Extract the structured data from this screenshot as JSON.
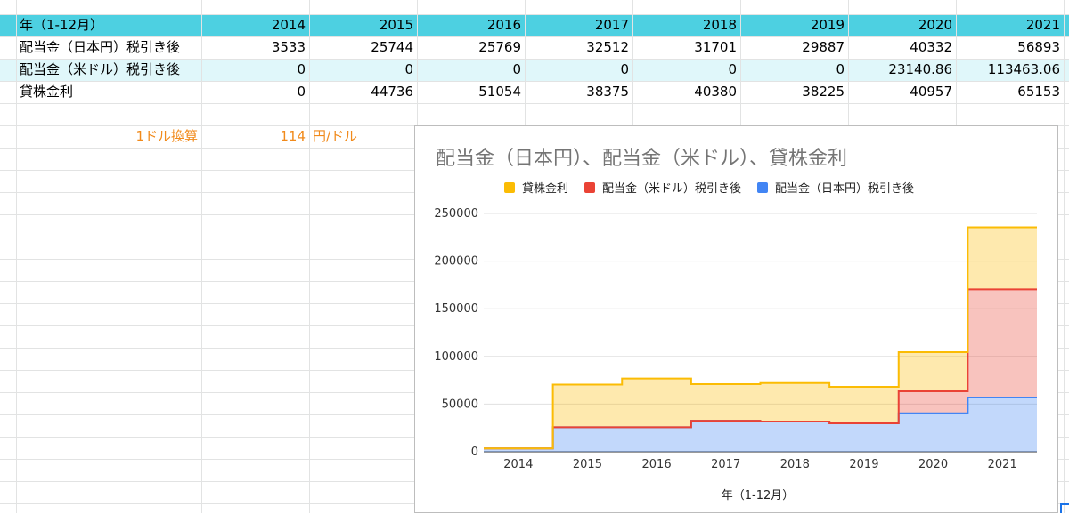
{
  "sheet": {
    "header": {
      "label": "年（1-12月）",
      "years": [
        "2014",
        "2015",
        "2016",
        "2017",
        "2018",
        "2019",
        "2020",
        "2021"
      ]
    },
    "rows": [
      {
        "label": "配当金（日本円）税引き後",
        "values": [
          "3533",
          "25744",
          "25769",
          "32512",
          "31701",
          "29887",
          "40332",
          "56893"
        ]
      },
      {
        "label": "配当金（米ドル）税引き後",
        "values": [
          "0",
          "0",
          "0",
          "0",
          "0",
          "0",
          "23140.86",
          "113463.06"
        ]
      },
      {
        "label": "貸株金利",
        "values": [
          "0",
          "44736",
          "51054",
          "38375",
          "40380",
          "38225",
          "40957",
          "65153"
        ]
      }
    ],
    "fx": {
      "label": "1ドル換算",
      "value": "114",
      "unit": "円/ドル"
    },
    "colors": {
      "header_bg": "#4dd0e1",
      "band_bg": "#e0f7fa",
      "fx_text": "#f18a1b"
    }
  },
  "chart_data": {
    "type": "area",
    "stacked": true,
    "stepped": true,
    "title": "配当金（日本円）、配当金（米ドル）、貸株金利",
    "xlabel": "年（1-12月）",
    "ylabel": "",
    "categories": [
      "2014",
      "2015",
      "2016",
      "2017",
      "2018",
      "2019",
      "2020",
      "2021"
    ],
    "ylim": [
      0,
      250000
    ],
    "yticks": [
      "0",
      "50000",
      "100000",
      "150000",
      "200000",
      "250000"
    ],
    "grid": true,
    "legend_position": "top",
    "legend_order": [
      "貸株金利",
      "配当金（米ドル）税引き後",
      "配当金（日本円）税引き後"
    ],
    "series": [
      {
        "name": "配当金（日本円）税引き後",
        "color": "#4285f4",
        "values": [
          3533,
          25744,
          25769,
          32512,
          31701,
          29887,
          40332,
          56893
        ]
      },
      {
        "name": "配当金（米ドル）税引き後",
        "color": "#ea4335",
        "values": [
          0,
          0,
          0,
          0,
          0,
          0,
          23140.86,
          113463.06
        ]
      },
      {
        "name": "貸株金利",
        "color": "#fbbc04",
        "values": [
          0,
          44736,
          51054,
          38375,
          40380,
          38225,
          40957,
          65153
        ]
      }
    ]
  }
}
